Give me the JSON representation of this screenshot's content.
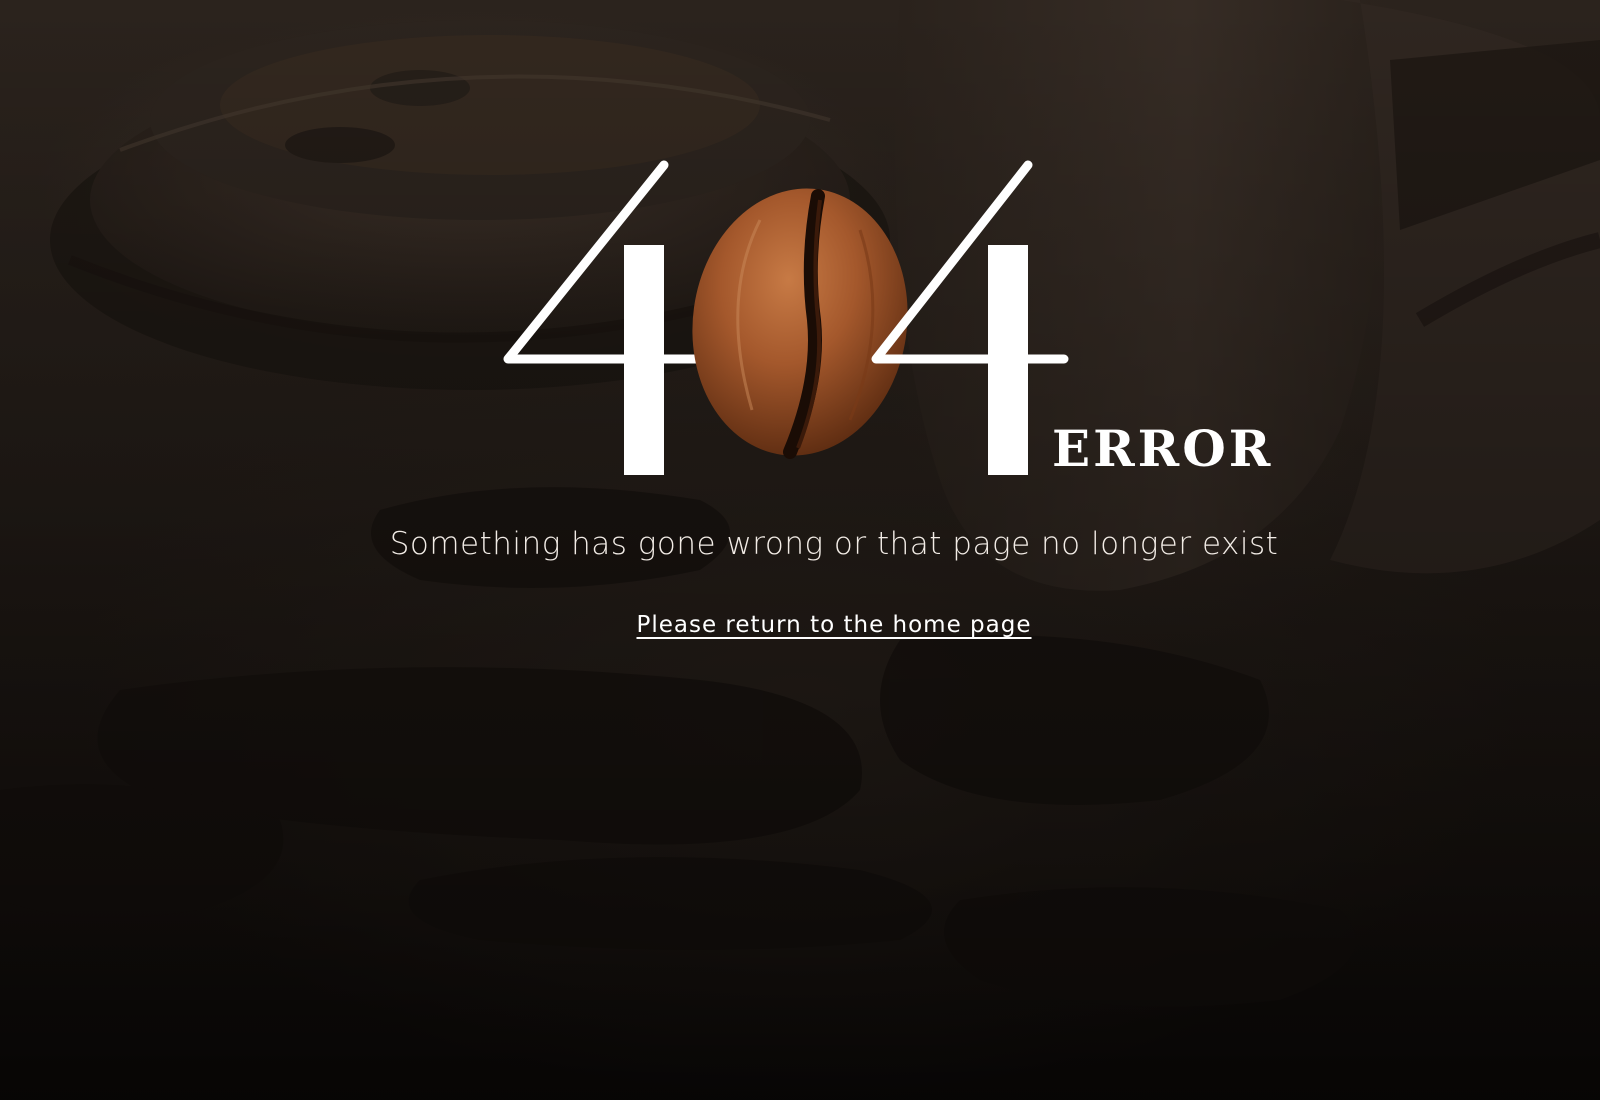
{
  "error_code": {
    "digits": [
      "4",
      "4"
    ],
    "center_icon": "coffee-bean-icon",
    "word": "ERROR"
  },
  "message": "Something has gone wrong or that page no longer exist",
  "home_link": {
    "label": "Please return to the home page"
  },
  "colors": {
    "background": "#241d18",
    "text": "#ffffff",
    "bean": "#a0552a"
  },
  "background_scene": "coffee-cup-lid-and-spill-photo"
}
